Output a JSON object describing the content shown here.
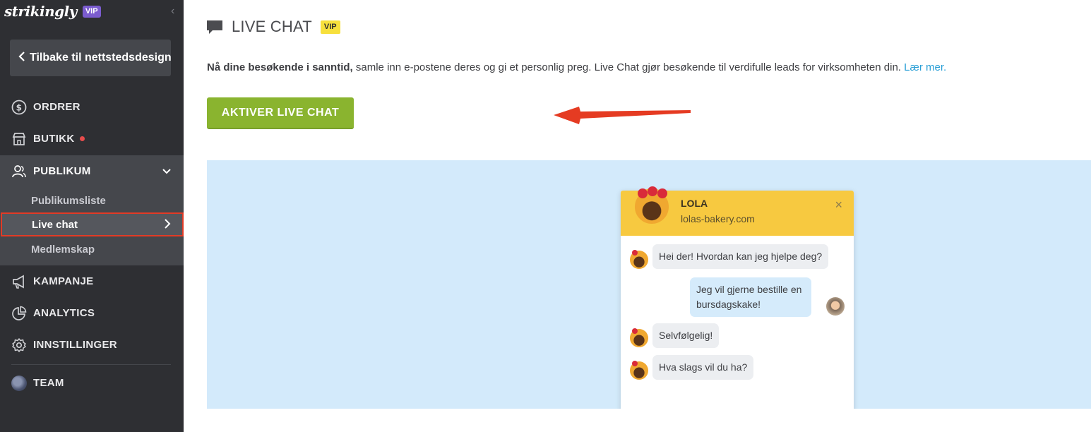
{
  "sidebar": {
    "brand": "strikingly",
    "brand_badge": "VIP",
    "collapse_glyph": "‹",
    "back_label": "Tilbake til nettstedsdesign",
    "items": [
      {
        "label": "ORDRER",
        "icon": "dollar-circle-icon"
      },
      {
        "label": "BUTIKK",
        "icon": "store-icon",
        "badge": "red-dot"
      },
      {
        "label": "PUBLIKUM",
        "icon": "people-icon",
        "expanded": true
      },
      {
        "label": "KAMPANJE",
        "icon": "megaphone-icon"
      },
      {
        "label": "ANALYTICS",
        "icon": "pie-chart-icon"
      },
      {
        "label": "INNSTILLINGER",
        "icon": "gear-icon"
      },
      {
        "label": "TEAM",
        "icon": "team-avatar"
      }
    ],
    "subitems": [
      {
        "label": "Publikumsliste"
      },
      {
        "label": "Live chat",
        "selected": true
      },
      {
        "label": "Medlemskap"
      }
    ]
  },
  "header": {
    "title": "LIVE CHAT",
    "badge": "VIP"
  },
  "description": {
    "bold": "Nå dine besøkende i sanntid,",
    "text": " samle inn e-postene deres og gi et personlig preg. Live Chat gjør besøkende til verdifulle leads for virksomheten din. ",
    "link": "Lær mer."
  },
  "activate_button": "AKTIVER LIVE CHAT",
  "chat_preview": {
    "agent_name": "LOLA",
    "agent_site": "lolas-bakery.com",
    "close_glyph": "×",
    "messages": [
      {
        "from": "agent",
        "text": "Hei der! Hvordan kan jeg hjelpe deg?"
      },
      {
        "from": "user",
        "text": "Jeg vil gjerne bestille en bursdagskake!"
      },
      {
        "from": "agent",
        "text": "Selvfølgelig!"
      },
      {
        "from": "agent",
        "text": "Hva slags vil du ha?"
      }
    ]
  },
  "colors": {
    "sidebar_bg": "#2e2f33",
    "accent_green": "#8ab42f",
    "link_blue": "#2a9fd6",
    "vip_purple": "#7b5ccf",
    "vip_yellow": "#f7e03c",
    "highlight_red": "#e23b26",
    "preview_bg": "#d3eafb",
    "widget_header": "#f7c940"
  }
}
